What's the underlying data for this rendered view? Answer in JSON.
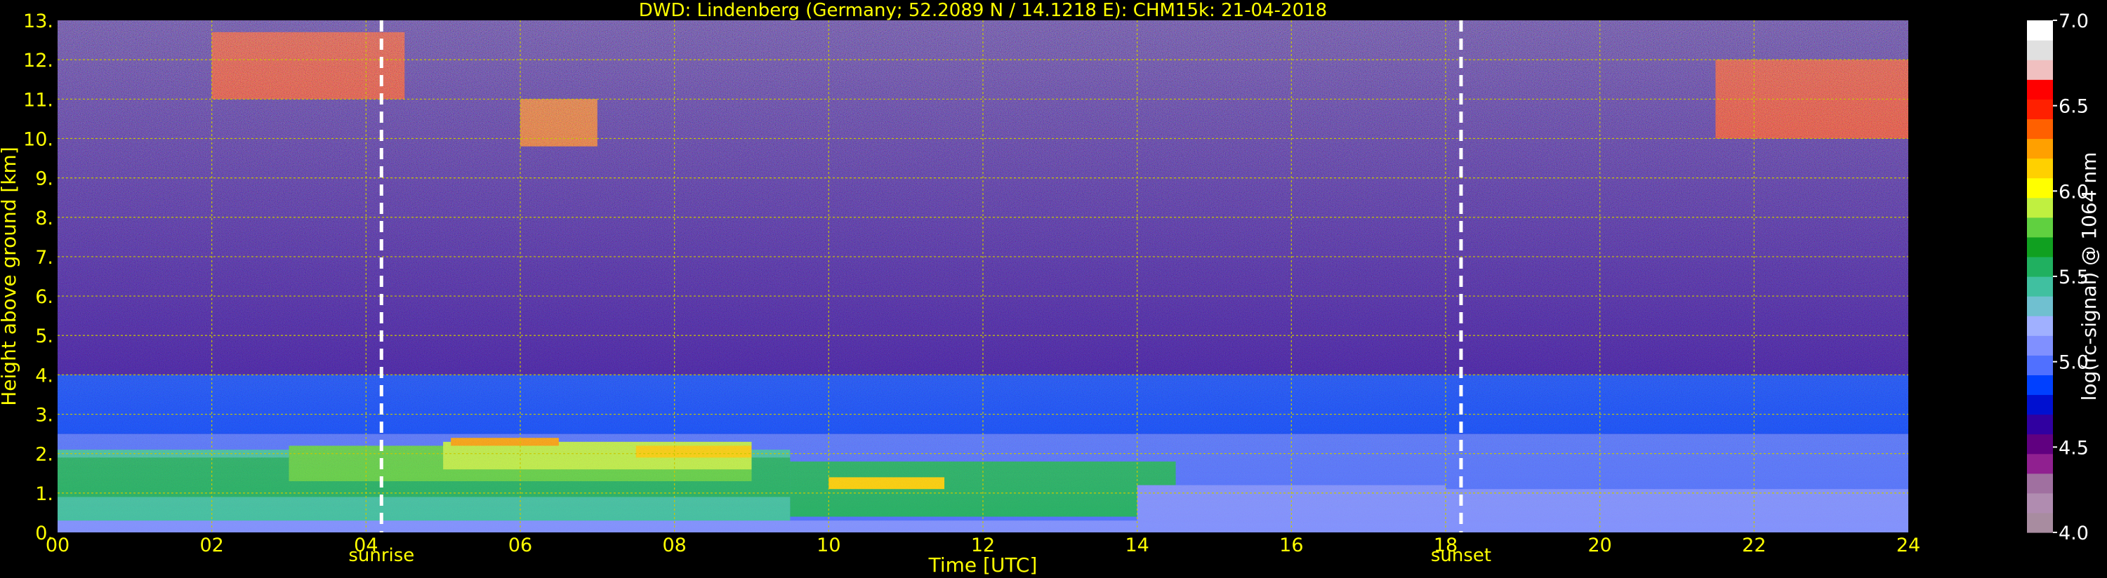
{
  "chart_data": {
    "type": "heatmap",
    "title": "DWD: Lindenberg (Germany; 52.2089 N / 14.1218 E):     CHM15k: 21-04-2018",
    "xlabel": "Time [UTC]",
    "ylabel": "Height above ground [km]",
    "xlim": [
      0,
      24
    ],
    "ylim": [
      0,
      13
    ],
    "x_ticks": [
      0,
      2,
      4,
      6,
      8,
      10,
      12,
      14,
      16,
      18,
      20,
      22,
      24
    ],
    "x_tick_labels": [
      "00",
      "02",
      "04",
      "06",
      "08",
      "10",
      "12",
      "14",
      "16",
      "18",
      "20",
      "22",
      "24"
    ],
    "y_ticks": [
      0,
      1,
      2,
      3,
      4,
      5,
      6,
      7,
      8,
      9,
      10,
      11,
      12,
      13
    ],
    "y_tick_labels": [
      "0.",
      "1.",
      "2.",
      "3.",
      "4.",
      "5.",
      "6.",
      "7.",
      "8.",
      "9.",
      "10.",
      "11.",
      "12.",
      "13."
    ],
    "grid": true,
    "annotations": [
      {
        "label": "sunrise",
        "x": 4.2
      },
      {
        "label": "sunset",
        "x": 18.2
      }
    ],
    "colorbar": {
      "label": "log(rc-signal) @ 1064 nm",
      "range": [
        4.0,
        7.0
      ],
      "ticks": [
        4.0,
        4.5,
        5.0,
        5.5,
        6.0,
        6.5,
        7.0
      ],
      "tick_labels": [
        "4.0",
        "4.5",
        "5.0",
        "5.5",
        "6.0",
        "6.5",
        "7.0"
      ],
      "colors": [
        "#a88ca0",
        "#b08cb0",
        "#a070a0",
        "#902090",
        "#600080",
        "#3000a0",
        "#0010d0",
        "#0040ff",
        "#5070ff",
        "#8090ff",
        "#a0b0ff",
        "#70c0d0",
        "#40c0a0",
        "#20b060",
        "#10a020",
        "#60d040",
        "#c0f040",
        "#ffff00",
        "#ffd000",
        "#ffa000",
        "#ff6000",
        "#ff2000",
        "#ff0000",
        "#f0c0c0",
        "#e0e0e0",
        "#ffffff"
      ]
    },
    "layers": [
      {
        "x0": 0,
        "x1": 24,
        "y0": 0,
        "y1": 13,
        "value": 4.6
      },
      {
        "x0": 0,
        "x1": 24,
        "y0": 2.5,
        "y1": 4.0,
        "value": 4.85
      },
      {
        "x0": 0,
        "x1": 24,
        "y0": 0,
        "y1": 2.5,
        "value": 5.0
      },
      {
        "x0": 0,
        "x1": 9.5,
        "y0": 0,
        "y1": 2.1,
        "value": 5.4
      },
      {
        "x0": 0,
        "x1": 9.5,
        "y0": 0.9,
        "y1": 1.9,
        "value": 5.55
      },
      {
        "x0": 3,
        "x1": 9,
        "y0": 1.3,
        "y1": 2.2,
        "value": 5.8
      },
      {
        "x0": 5,
        "x1": 9,
        "y0": 1.6,
        "y1": 2.3,
        "value": 5.9
      },
      {
        "x0": 7.5,
        "x1": 9,
        "y0": 1.9,
        "y1": 2.2,
        "value": 6.1
      },
      {
        "x0": 5.1,
        "x1": 6.5,
        "y0": 2.2,
        "y1": 2.4,
        "value": 6.2
      },
      {
        "x0": 9.5,
        "x1": 14.5,
        "y0": 0.4,
        "y1": 1.8,
        "value": 5.55
      },
      {
        "x0": 10,
        "x1": 11.5,
        "y0": 1.1,
        "y1": 1.4,
        "value": 6.1
      },
      {
        "x0": 14,
        "x1": 18,
        "y0": 0.1,
        "y1": 1.2,
        "value": 5.15
      },
      {
        "x0": 18,
        "x1": 24,
        "y0": 0.05,
        "y1": 1.1,
        "value": 5.1
      },
      {
        "x0": 0,
        "x1": 24,
        "y0": 0,
        "y1": 0.3,
        "value": 5.05
      },
      {
        "x0": 2,
        "x1": 4.5,
        "y0": 11,
        "y1": 12.7,
        "value": 6.5
      },
      {
        "x0": 6,
        "x1": 7,
        "y0": 9.8,
        "y1": 11,
        "value": 6.4
      },
      {
        "x0": 21.5,
        "x1": 24,
        "y0": 10,
        "y1": 12,
        "value": 6.5
      }
    ]
  }
}
